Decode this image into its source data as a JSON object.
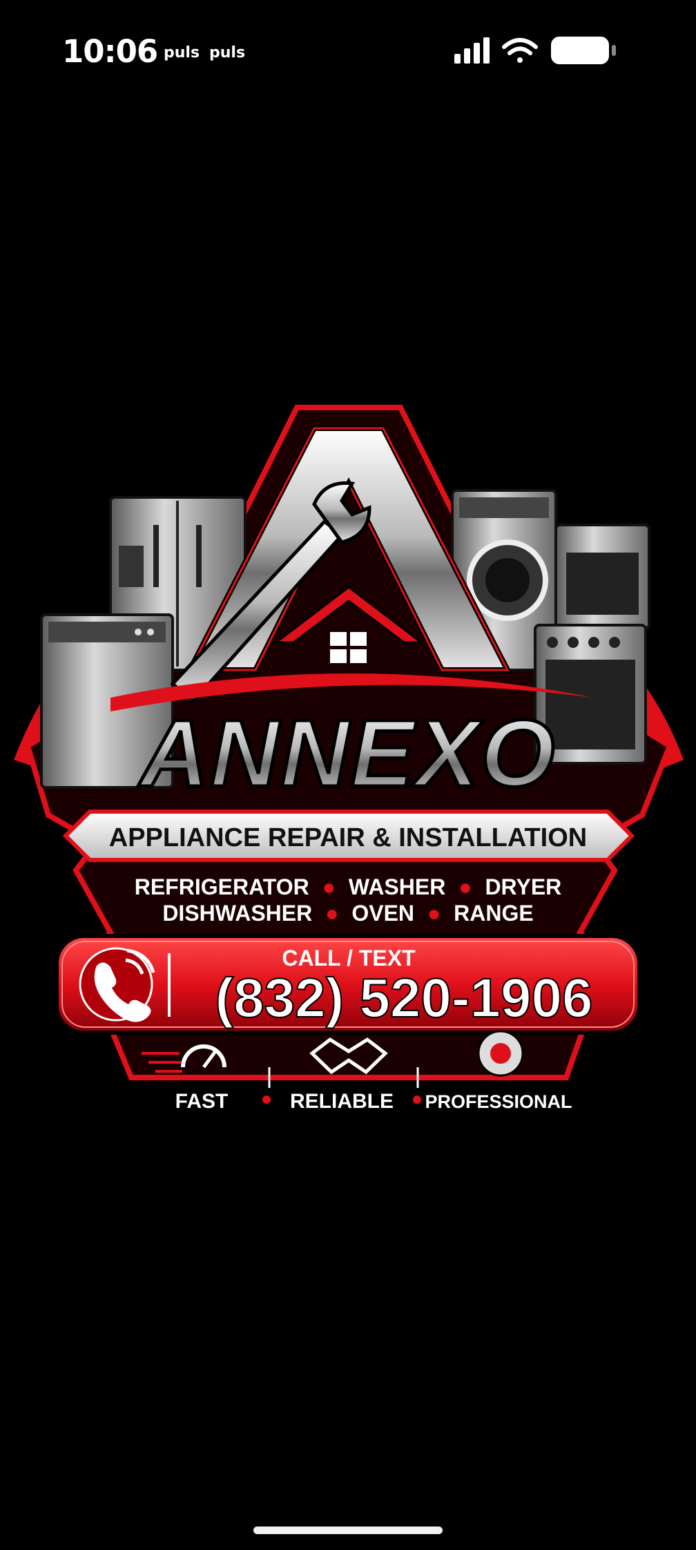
{
  "status_bar": {
    "time": "10:06",
    "carriers": [
      "puls",
      "puls"
    ],
    "icons": [
      "signal-bars-icon",
      "wifi-icon",
      "battery-icon"
    ]
  },
  "logo": {
    "brand_name": "ANNEXO",
    "tagline": "APPLIANCE REPAIR & INSTALLATION",
    "services_line1": {
      "items": [
        "REFRIGERATOR",
        "WASHER",
        "DRYER"
      ]
    },
    "services_line2": {
      "items": [
        "DISHWASHER",
        "OVEN",
        "RANGE"
      ]
    },
    "call_label": "CALL / TEXT",
    "phone": "(832) 520-1906",
    "features": [
      "FAST",
      "RELIABLE",
      "PROFESSIONAL"
    ],
    "icons": [
      "refrigerator-icon",
      "dishwasher-icon",
      "washer-icon",
      "oven-icon",
      "range-icon",
      "wrench-icon",
      "house-icon",
      "phone-icon",
      "speedometer-icon",
      "handshake-icon",
      "gear-icon"
    ],
    "colors": {
      "red": "#e0101a",
      "dark_red": "#8a0008",
      "silver": "#d8d8d8",
      "black": "#000000"
    }
  }
}
